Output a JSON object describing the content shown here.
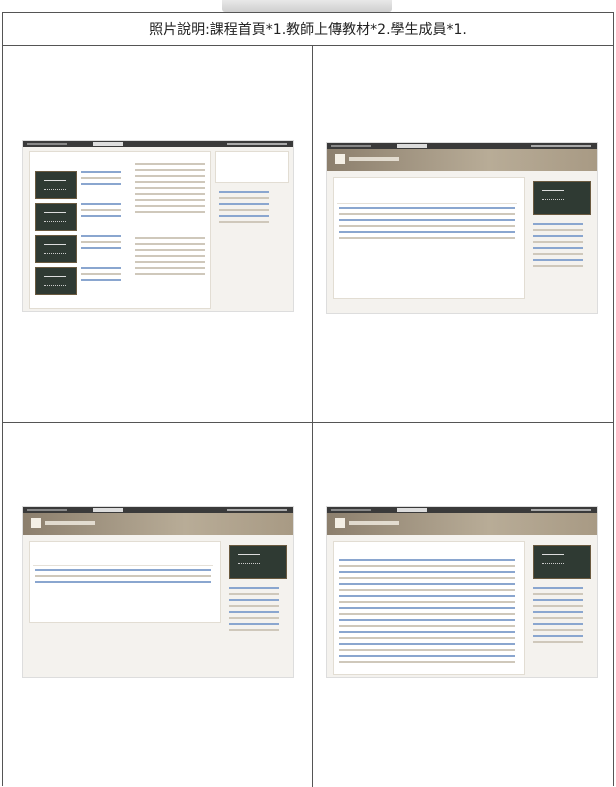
{
  "header": {
    "top_text": ""
  },
  "caption": {
    "text": "照片說明:課程首頁*1.教師上傳教材*2.學生成員*1."
  },
  "cells": [
    {
      "id": "course-home",
      "desc": ""
    },
    {
      "id": "teacher-material-1",
      "desc": ""
    },
    {
      "id": "teacher-material-2",
      "desc": ""
    },
    {
      "id": "student-members",
      "desc": ""
    }
  ],
  "icons": {
    "board": "chalkboard-thumbnail"
  }
}
